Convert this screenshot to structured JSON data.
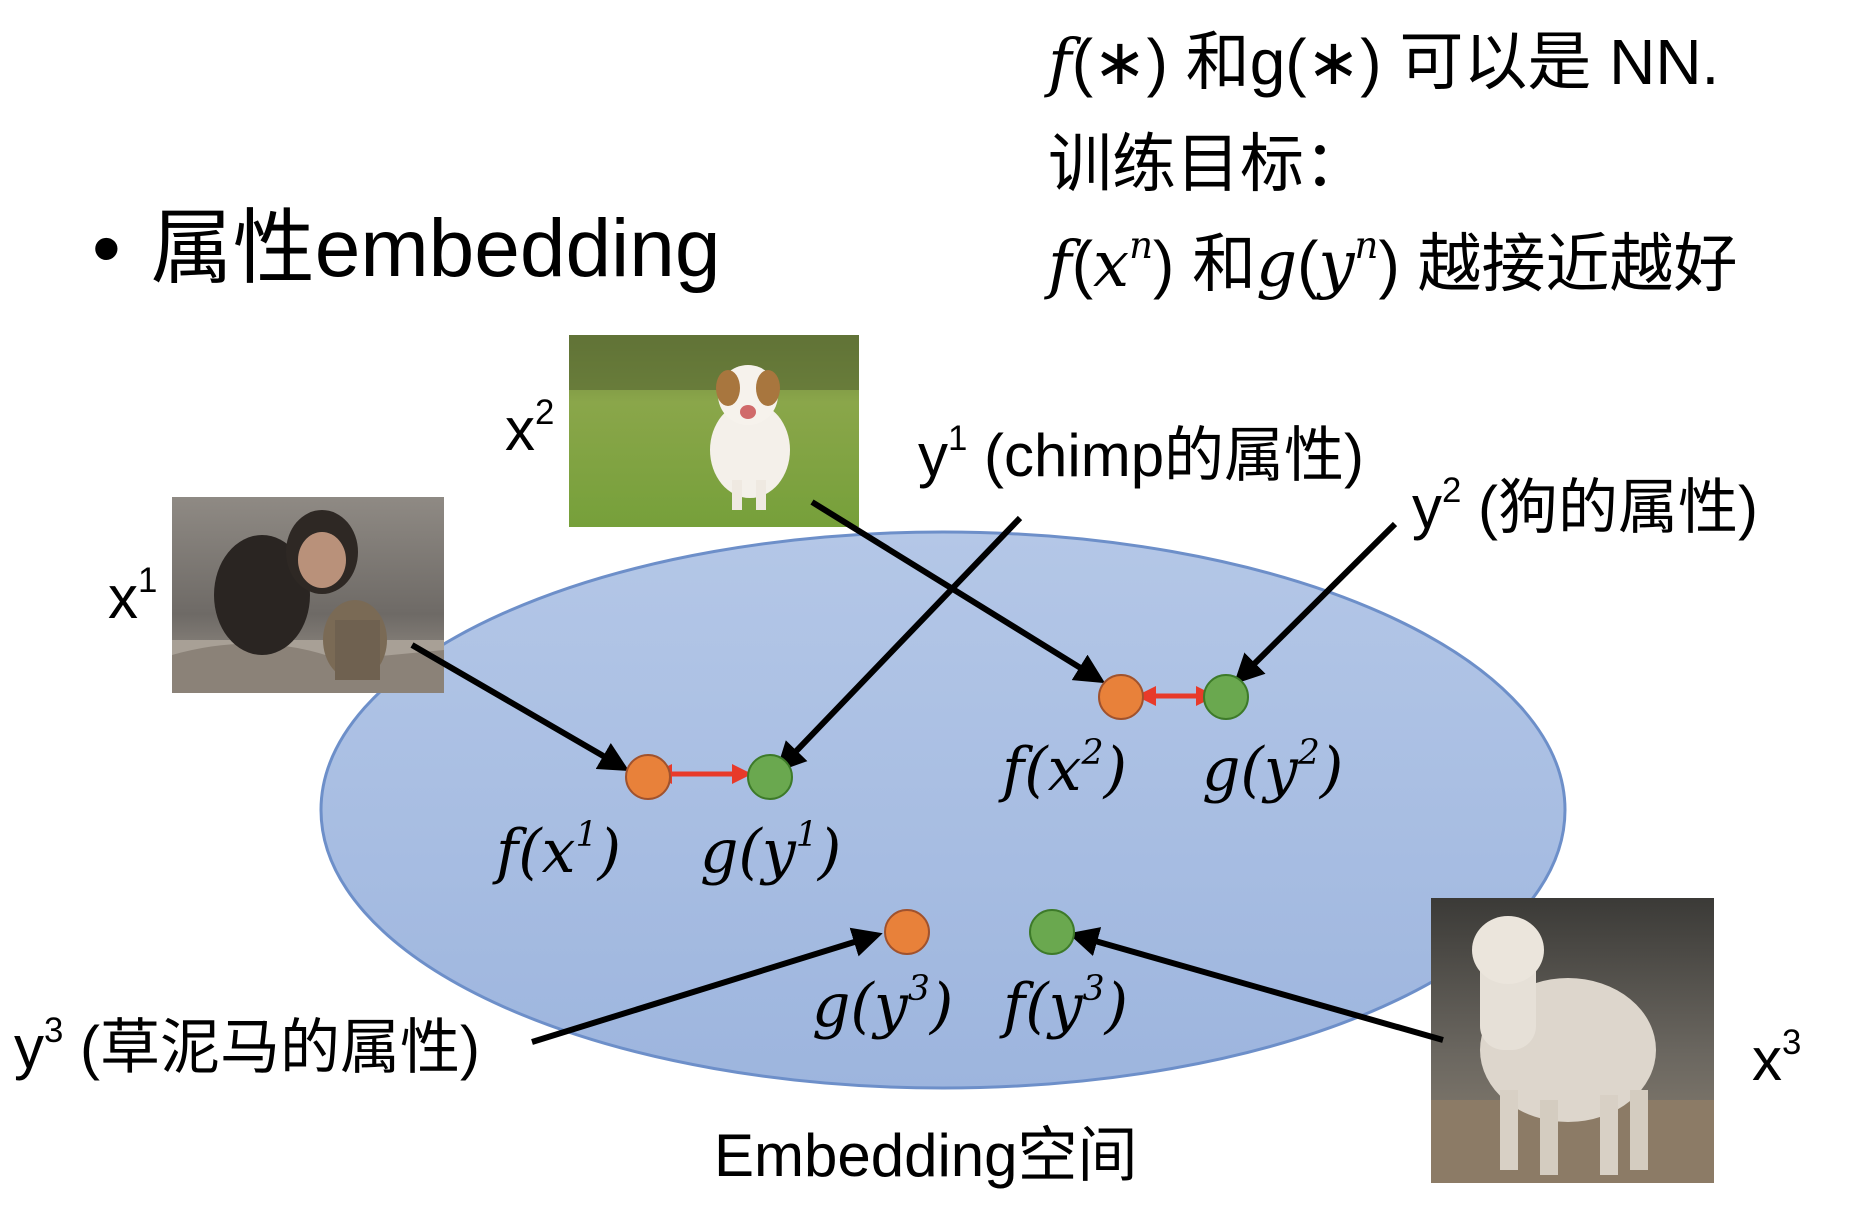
{
  "title": {
    "bullet": "•",
    "text": "属性embedding"
  },
  "notes": {
    "line1": {
      "f": "f",
      "lp": "(",
      "star": "∗",
      "rp": ")",
      "mid": " 和g(",
      "star2": "∗",
      "end": ") 可以是 NN."
    },
    "line2": "训练目标：",
    "line3": {
      "f": "f",
      "x": "x",
      "n": "n",
      "mid": " 和",
      "g": "g",
      "y": "y",
      "n2": "n",
      "end": ") 越接近越好"
    }
  },
  "images": [
    {
      "name": "chimpanzee-photo",
      "label_base": "x",
      "label_sup": "1"
    },
    {
      "name": "dog-photo",
      "label_base": "x",
      "label_sup": "2"
    },
    {
      "name": "alpaca-photo",
      "label_base": "x",
      "label_sup": "3"
    }
  ],
  "attributes": [
    {
      "base": "y",
      "sup": "1",
      "text": " (chimp的属性)"
    },
    {
      "base": "y",
      "sup": "2",
      "text": " (狗的属性)"
    },
    {
      "base": "y",
      "sup": "3",
      "text": " (草泥马的属性)"
    }
  ],
  "points": {
    "pair1": {
      "f_label": "f(x",
      "f_sup": "1",
      "g_label": "g(y",
      "g_sup": "1"
    },
    "pair2": {
      "f_label": "f(x",
      "f_sup": "2",
      "g_label": "g(y",
      "g_sup": "2"
    },
    "pair3": {
      "g_label": "g(y",
      "g_sup": "3",
      "f_label": "f(y",
      "f_sup": "3"
    }
  },
  "space_label": "Embedding空间",
  "colors": {
    "ellipse_fill_top": "#b4c7e7",
    "ellipse_fill_bottom": "#9db5de",
    "ellipse_stroke": "#6d8fc9",
    "orange_point": "#e8813a",
    "green_point": "#6aa84f",
    "arrow_black": "#000000",
    "arrow_red": "#e83a2a"
  }
}
